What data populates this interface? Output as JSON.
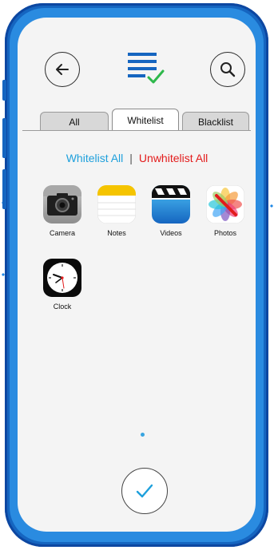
{
  "header": {
    "back_icon": "arrow-left-icon",
    "logo_icon": "checklist-icon",
    "search_icon": "search-icon"
  },
  "tabs": [
    {
      "label": "All",
      "active": false
    },
    {
      "label": "Whitelist",
      "active": true
    },
    {
      "label": "Blacklist",
      "active": false
    }
  ],
  "actions": {
    "whitelist_all": "Whitelist All",
    "separator": "|",
    "unwhitelist_all": "Unwhitelist All"
  },
  "apps": [
    {
      "label": "Camera",
      "icon": "camera-icon"
    },
    {
      "label": "Notes",
      "icon": "notes-icon"
    },
    {
      "label": "Videos",
      "icon": "videos-icon"
    },
    {
      "label": "Photos",
      "icon": "photos-icon"
    },
    {
      "label": "Clock",
      "icon": "clock-icon"
    }
  ],
  "footer": {
    "confirm_icon": "checkmark-icon"
  },
  "colors": {
    "frame": "#1565c0",
    "accent": "#1ea0dc",
    "danger": "#e31b1b"
  }
}
